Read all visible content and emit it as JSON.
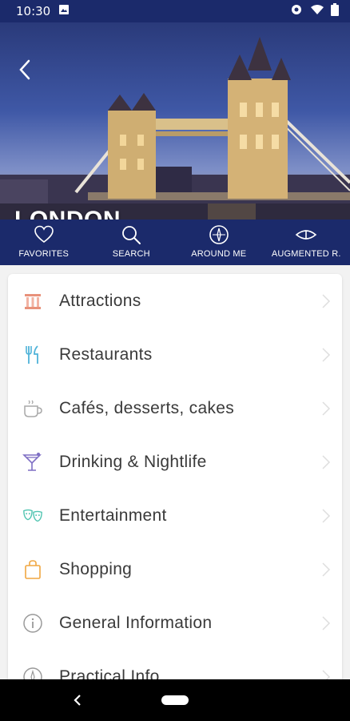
{
  "status_bar": {
    "time": "10:30"
  },
  "header": {
    "title": "LONDON"
  },
  "tabs": [
    {
      "id": "favorites",
      "label": "FAVORITES",
      "icon": "heart-icon"
    },
    {
      "id": "search",
      "label": "SEARCH",
      "icon": "search-icon"
    },
    {
      "id": "around-me",
      "label": "AROUND ME",
      "icon": "compass-icon"
    },
    {
      "id": "augmented",
      "label": "AUGMENTED R.",
      "icon": "eye-icon"
    }
  ],
  "menu": {
    "items": [
      {
        "label": "Attractions",
        "icon": "landmark-icon",
        "color": "#e8917a"
      },
      {
        "label": "Restaurants",
        "icon": "cutlery-icon",
        "color": "#4fb3d9"
      },
      {
        "label": "Cafés, desserts, cakes",
        "icon": "coffee-cup-icon",
        "color": "#a9a9a9"
      },
      {
        "label": "Drinking & Nightlife",
        "icon": "cocktail-icon",
        "color": "#7f6fc4"
      },
      {
        "label": "Entertainment",
        "icon": "theater-masks-icon",
        "color": "#4fc4b0"
      },
      {
        "label": "Shopping",
        "icon": "shopping-bag-icon",
        "color": "#f0a640"
      },
      {
        "label": "General Information",
        "icon": "info-icon",
        "color": "#9a9a9a"
      },
      {
        "label": "Practical Info",
        "icon": "compass-icon",
        "color": "#9a9a9a"
      }
    ]
  },
  "colors": {
    "brand": "#1b2a6b",
    "card": "#ffffff",
    "text": "#3a3a3a"
  }
}
